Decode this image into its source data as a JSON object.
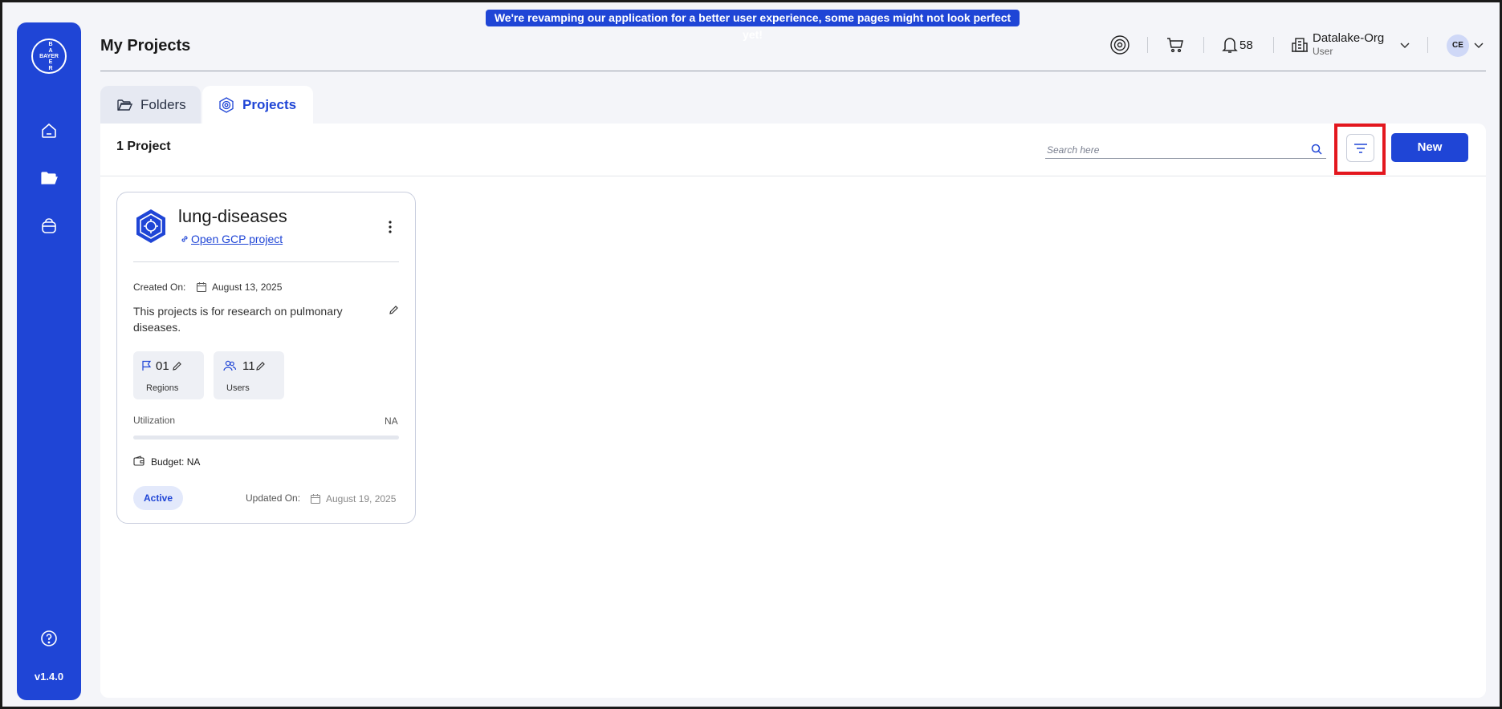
{
  "banner": {
    "text": "We're revamping our application for a better user experience, some pages might not look perfect yet!"
  },
  "sidebar": {
    "logo_vertical": [
      "B",
      "A",
      "Y",
      "E",
      "R"
    ],
    "logo_horizontal": "BAYER",
    "items": [
      {
        "icon": "home-icon"
      },
      {
        "icon": "folder-icon"
      },
      {
        "icon": "bag-icon"
      },
      {
        "icon": "help-icon"
      }
    ],
    "version": "v1.4.0"
  },
  "header": {
    "title": "My Projects",
    "notifications_count": "58",
    "org_name": "Datalake-Org",
    "org_role": "User",
    "avatar_initials": "CE"
  },
  "tabs": [
    {
      "label": "Folders",
      "icon": "folder-outline-icon",
      "active": false
    },
    {
      "label": "Projects",
      "icon": "project-gear-icon",
      "active": true
    }
  ],
  "toolbar": {
    "count_label": "1 Project",
    "search_placeholder": "Search here",
    "new_label": "New"
  },
  "projects": [
    {
      "name": "lung-diseases",
      "link_label": "Open GCP project",
      "created_label": "Created On:",
      "created_date": "August 13, 2025",
      "description": "This projects is for research on pulmonary diseases.",
      "regions_value": "01",
      "regions_label": "Regions",
      "users_value": "11",
      "users_label": "Users",
      "utilization_label": "Utilization",
      "utilization_value": "NA",
      "utilization_fraction": 0,
      "budget": "Budget: NA",
      "status": "Active",
      "updated_label": "Updated On:",
      "updated_date": "August 19, 2025"
    }
  ],
  "colors": {
    "accent": "#1f45d6",
    "highlight": "#e3171e",
    "background": "#f4f5f9"
  }
}
